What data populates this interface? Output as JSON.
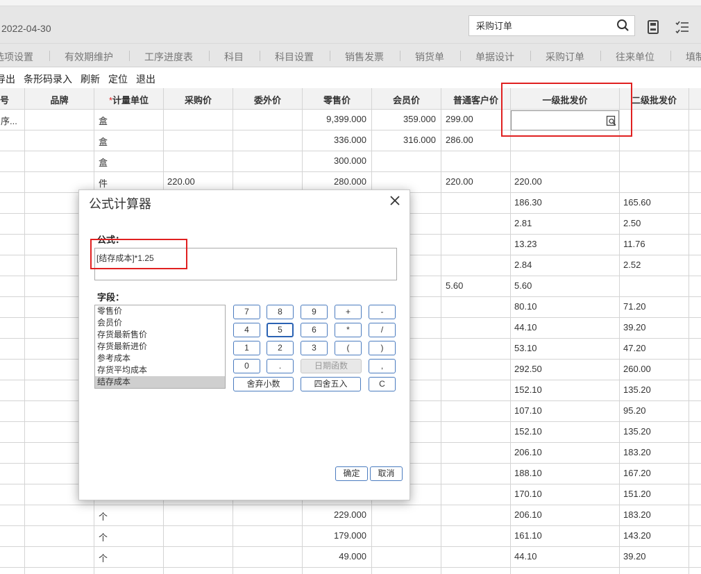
{
  "header": {
    "date": "2022-04-30",
    "search_value": "采购订单",
    "search_icon": "search-icon",
    "icons": [
      "calculator-icon",
      "checklist-icon"
    ]
  },
  "menubar": {
    "items": [
      "选项设置",
      "有效期维护",
      "工序进度表",
      "科目",
      "科目设置",
      "销售发票",
      "销货单",
      "单据设计",
      "采购订单",
      "往来单位",
      "填制"
    ]
  },
  "toolbar": {
    "items": [
      "导出",
      "条形码录入",
      "刷新",
      "定位",
      "退出"
    ]
  },
  "table": {
    "headers": [
      "号",
      "品牌",
      "计量单位",
      "采购价",
      "委外价",
      "零售价",
      "会员价",
      "普通客户价",
      "一级批发价",
      "二级批发价"
    ],
    "required_mark": "*",
    "rows": [
      [
        "序...",
        "",
        "盒",
        "",
        "",
        "9,399.000",
        "359.000",
        "299.00",
        "",
        ""
      ],
      [
        "",
        "",
        "盒",
        "",
        "",
        "336.000",
        "316.000",
        "286.00",
        "",
        ""
      ],
      [
        "",
        "",
        "盒",
        "",
        "",
        "300.000",
        "",
        "",
        "",
        ""
      ],
      [
        "",
        "",
        "件",
        "220.00",
        "",
        "280.000",
        "",
        "220.00",
        "220.00",
        ""
      ],
      [
        "",
        "",
        "",
        "",
        "",
        "",
        "",
        "",
        "186.30",
        "165.60"
      ],
      [
        "",
        "",
        "",
        "",
        "",
        "",
        "",
        "",
        "2.81",
        "2.50"
      ],
      [
        "",
        "",
        "",
        "",
        "",
        "",
        "",
        "",
        "13.23",
        "11.76"
      ],
      [
        "",
        "",
        "",
        "",
        "",
        "",
        "",
        "",
        "2.84",
        "2.52"
      ],
      [
        "",
        "",
        "",
        "",
        "",
        "",
        "",
        "5.60",
        "5.60",
        ""
      ],
      [
        "",
        "",
        "",
        "",
        "",
        "",
        "",
        "",
        "80.10",
        "71.20"
      ],
      [
        "",
        "",
        "",
        "",
        "",
        "",
        "",
        "",
        "44.10",
        "39.20"
      ],
      [
        "",
        "",
        "",
        "",
        "",
        "",
        "",
        "",
        "53.10",
        "47.20"
      ],
      [
        "",
        "",
        "",
        "",
        "",
        "",
        "",
        "",
        "292.50",
        "260.00"
      ],
      [
        "",
        "",
        "",
        "",
        "",
        "",
        "",
        "",
        "152.10",
        "135.20"
      ],
      [
        "",
        "",
        "",
        "",
        "",
        "",
        "",
        "",
        "107.10",
        "95.20"
      ],
      [
        "",
        "",
        "",
        "",
        "",
        "",
        "",
        "",
        "152.10",
        "135.20"
      ],
      [
        "",
        "",
        "",
        "",
        "",
        "",
        "",
        "",
        "206.10",
        "183.20"
      ],
      [
        "",
        "",
        "",
        "",
        "",
        "",
        "",
        "",
        "188.10",
        "167.20"
      ],
      [
        "",
        "",
        "",
        "",
        "",
        "",
        "",
        "",
        "170.10",
        "151.20"
      ],
      [
        "",
        "",
        "个",
        "",
        "",
        "229.000",
        "",
        "",
        "206.10",
        "183.20"
      ],
      [
        "",
        "",
        "个",
        "",
        "",
        "179.000",
        "",
        "",
        "161.10",
        "143.20"
      ],
      [
        "",
        "",
        "个",
        "",
        "",
        "49.000",
        "",
        "",
        "44.10",
        "39.20"
      ]
    ]
  },
  "dialog": {
    "title": "公式计算器",
    "formula_label": "公式：",
    "formula_value": "[结存成本]*1.25",
    "fields_label": "字段：",
    "fields": [
      "零售价",
      "会员价",
      "存货最新售价",
      "存货最新进价",
      "参考成本",
      "存货平均成本",
      "结存成本"
    ],
    "selected_field": "结存成本",
    "keys": [
      "7",
      "8",
      "9",
      "+",
      "-",
      "4",
      "5",
      "6",
      "*",
      "/",
      "1",
      "2",
      "3",
      "(",
      ")",
      "0",
      ".",
      "日期函数",
      ","
    ],
    "round_down": "舍弃小数",
    "round_half": "四舍五入",
    "clear": "C",
    "ok": "确定",
    "cancel": "取消"
  },
  "colors": {
    "highlight": "#e02020",
    "header_bg": "#e6e6e6",
    "button_border": "#4a7bbf"
  }
}
